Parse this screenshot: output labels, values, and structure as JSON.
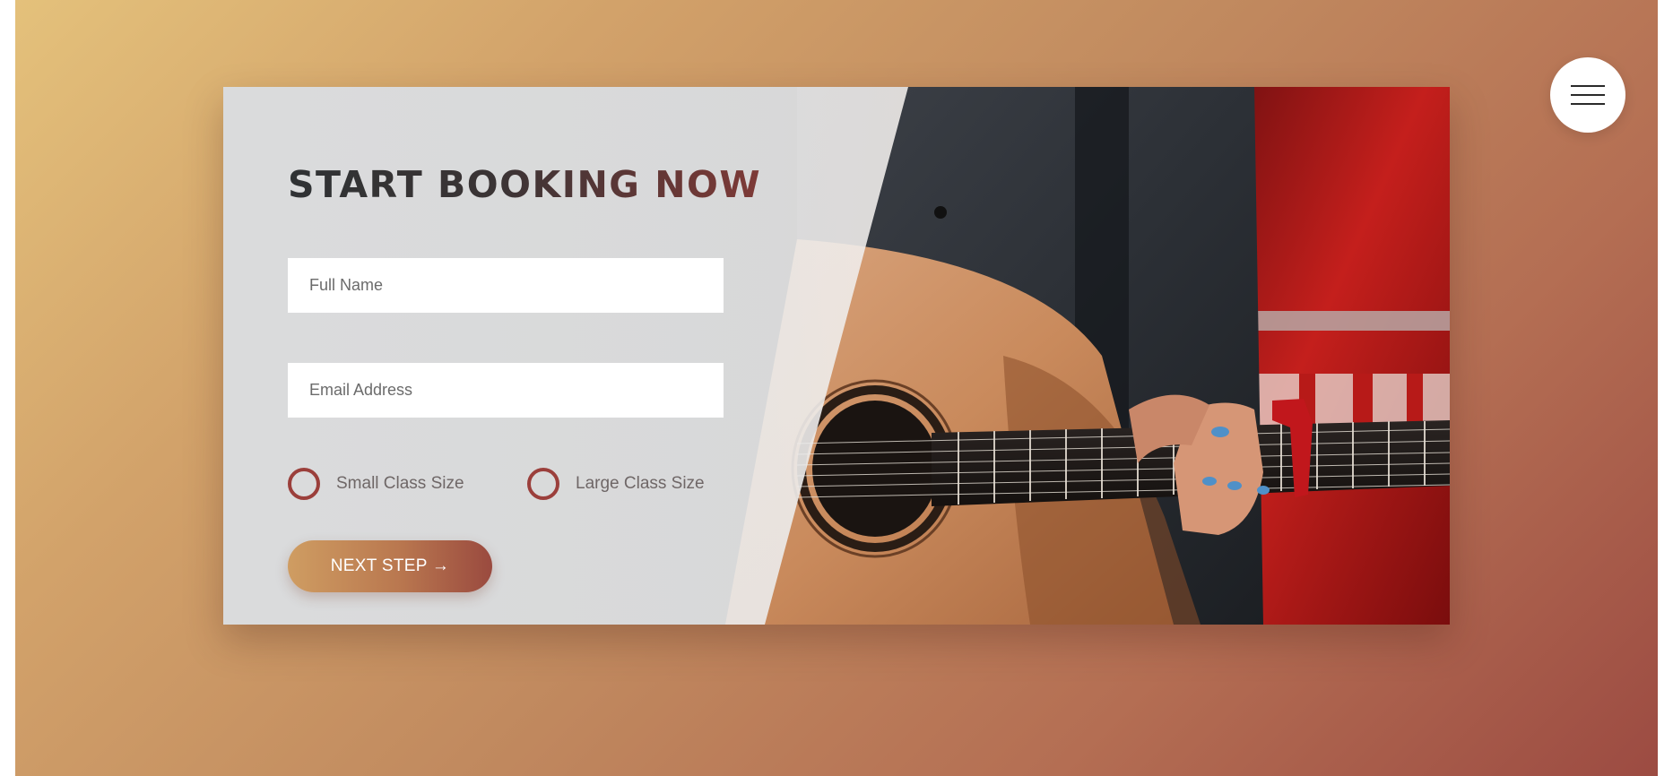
{
  "colors": {
    "background_gradient_start": "#e4c17b",
    "background_gradient_end": "#9c4b42",
    "accent": "#9b3f3b",
    "title_dark": "#2f3234",
    "title_accent": "#7e3a37",
    "button_gradient_start": "#cf9d62",
    "button_gradient_end": "#9a4a3f"
  },
  "menu": {
    "icon": "hamburger-menu-icon"
  },
  "booking": {
    "title": "START BOOKING NOW",
    "full_name": {
      "value": "",
      "placeholder": "Full Name"
    },
    "email": {
      "value": "",
      "placeholder": "Email Address"
    },
    "class_size_options": [
      {
        "label": "Small Class Size",
        "selected": false
      },
      {
        "label": "Large Class Size",
        "selected": false
      }
    ],
    "next_button_label": "NEXT STEP →"
  },
  "hero_image": {
    "subject": "guitarist-playing-acoustic-guitar"
  }
}
